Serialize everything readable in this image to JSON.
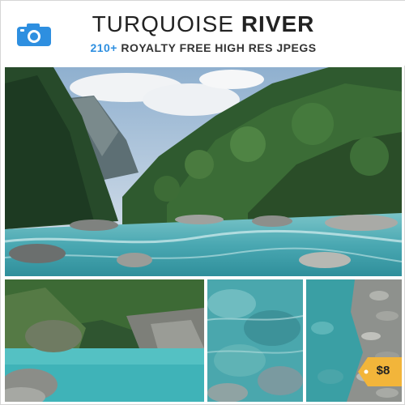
{
  "header": {
    "title_light": "TURQUOISE",
    "title_bold": "RIVER",
    "subtitle_count": "210+",
    "subtitle_rest": "ROYALTY FREE HIGH RES JPEGS",
    "icon": "camera-icon"
  },
  "price": {
    "label": "$8"
  },
  "colors": {
    "accent_blue": "#2e8fe0",
    "price_gold": "#f2b53a",
    "water_turquoise": "#3fb3b8"
  }
}
